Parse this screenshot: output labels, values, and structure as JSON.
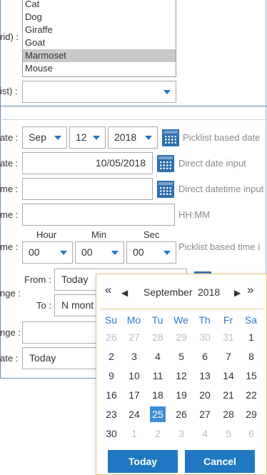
{
  "species_list": {
    "label": "rid) :",
    "items": [
      "Cat",
      "Dog",
      "Giraffe",
      "Goat",
      "Marmoset",
      "Mouse"
    ],
    "selected_index": 4
  },
  "picklist_row": {
    "label": "ist) :",
    "value": ""
  },
  "date_picklist_row": {
    "label": "ate :",
    "month": "Sep",
    "day": "12",
    "year": "2018",
    "hint": "Picklist based date"
  },
  "direct_date_row": {
    "label": "ate :",
    "value": "10/05/2018",
    "hint": "Direct date input"
  },
  "datetime_row": {
    "label": "me :",
    "value": "",
    "hint": "Direct datetime input"
  },
  "time_input_row": {
    "label": "me :",
    "value": "",
    "hint": "HH:MM"
  },
  "time_picklist_row": {
    "label": "me :",
    "hour_header": "Hour",
    "min_header": "Min",
    "sec_header": "Sec",
    "hour": "00",
    "min": "00",
    "sec": "00",
    "hint": "Picklist based time i"
  },
  "range_row": {
    "label": "nge :",
    "from_label": "From :",
    "from_value": "Today",
    "to_label": "To :",
    "to_value": "N mont"
  },
  "range2_row": {
    "label": "nge :",
    "value": ""
  },
  "relative_date_row": {
    "label": "ate :",
    "value": "Today"
  },
  "calendar": {
    "month": "September",
    "year": "2018",
    "nav_prev_year": "«",
    "nav_prev_month": "◀",
    "nav_next_month": "▶",
    "nav_next_year": "»",
    "weekdays": [
      "Su",
      "Mo",
      "Tu",
      "We",
      "Th",
      "Fr",
      "Sa"
    ],
    "weeks": [
      [
        "26",
        "27",
        "28",
        "29",
        "30",
        "31",
        "1"
      ],
      [
        "2",
        "3",
        "4",
        "5",
        "6",
        "7",
        "8"
      ],
      [
        "9",
        "10",
        "11",
        "12",
        "13",
        "14",
        "15"
      ],
      [
        "16",
        "17",
        "18",
        "19",
        "20",
        "21",
        "22"
      ],
      [
        "23",
        "24",
        "25",
        "26",
        "27",
        "28",
        "29"
      ],
      [
        "30",
        "1",
        "2",
        "3",
        "4",
        "5",
        "6"
      ]
    ],
    "selected_day": "25",
    "today_label": "Today",
    "cancel_label": "Cancel",
    "accent_color": "#1f78c1",
    "selected_color": "#3b8fd8"
  },
  "icons": {
    "calendar": "calendar-icon",
    "dropdown": "chevron-down-icon"
  }
}
